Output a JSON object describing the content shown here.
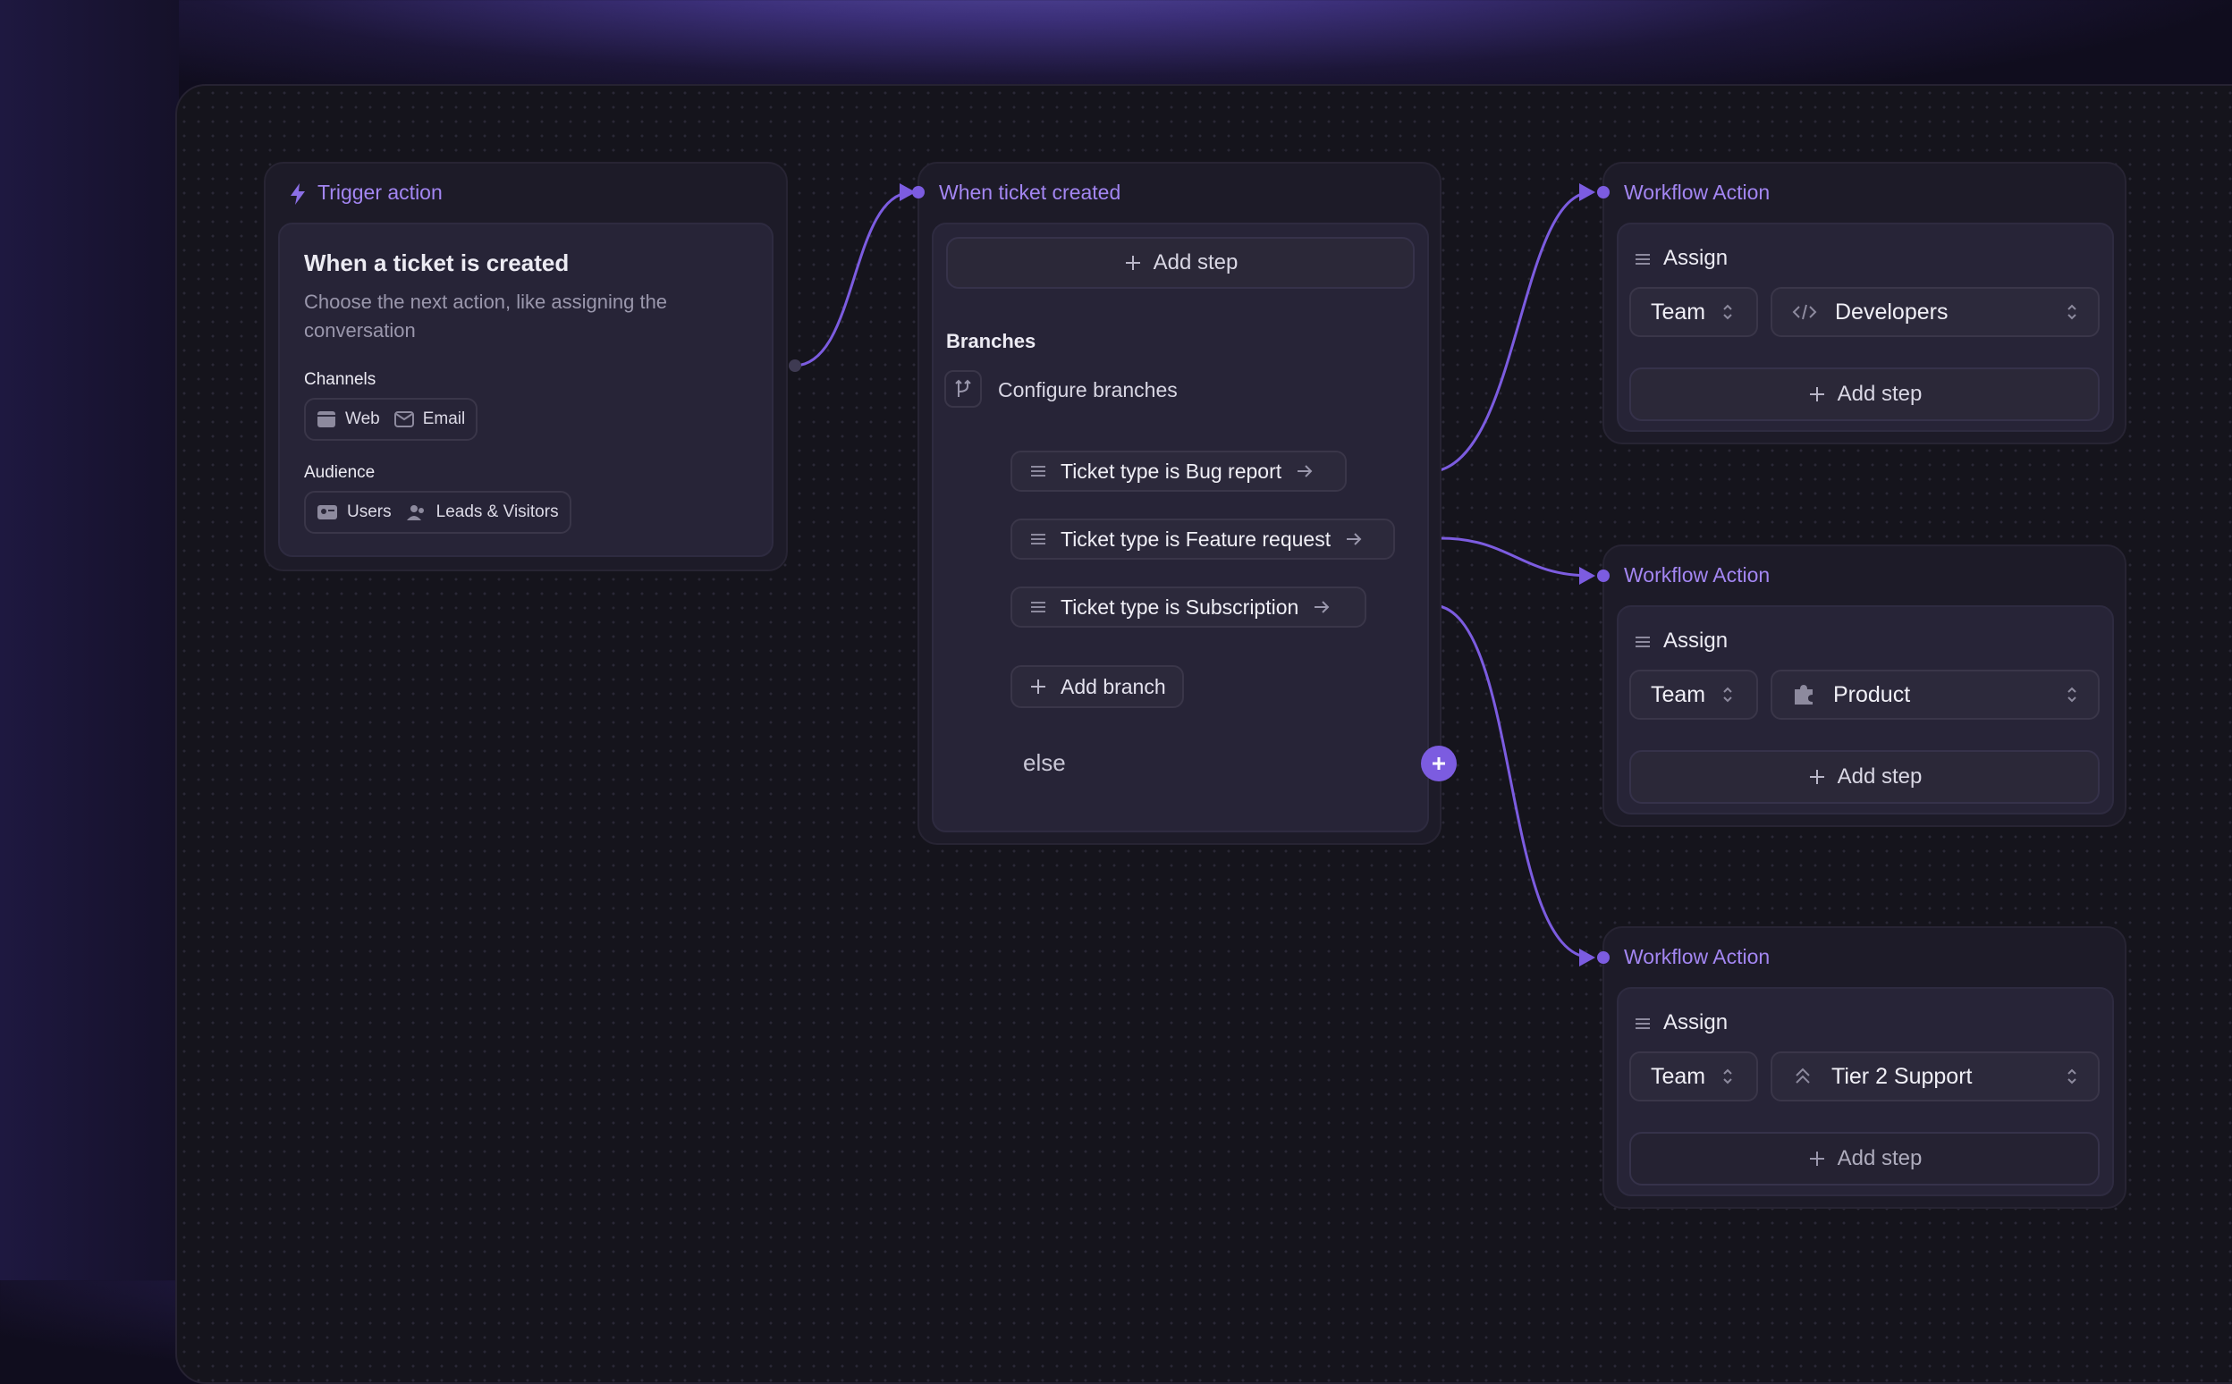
{
  "trigger": {
    "title": "Trigger action",
    "heading": "When a ticket is created",
    "description_line1": "Choose the next action, like assigning the",
    "description_line2": "conversation",
    "channels_label": "Channels",
    "channels": [
      "Web",
      "Email"
    ],
    "audience_label": "Audience",
    "audience": [
      "Users",
      "Leads & Visitors"
    ]
  },
  "branching": {
    "title": "When ticket created",
    "add_step": "Add step",
    "branches_label": "Branches",
    "configure_label": "Configure branches",
    "branches": [
      "Ticket type is Bug report",
      "Ticket type is Feature request",
      "Ticket type is Subscription"
    ],
    "add_branch": "Add branch",
    "else_label": "else"
  },
  "actions": [
    {
      "title": "Workflow Action",
      "action": "Assign",
      "field": "Team",
      "value": "Developers",
      "value_icon": "code-icon",
      "add_step": "Add step"
    },
    {
      "title": "Workflow Action",
      "action": "Assign",
      "field": "Team",
      "value": "Product",
      "value_icon": "puzzle-icon",
      "add_step": "Add step"
    },
    {
      "title": "Workflow Action",
      "action": "Assign",
      "field": "Team",
      "value": "Tier 2 Support",
      "value_icon": "chevrons-up-icon",
      "add_step": "Add step"
    }
  ],
  "colors": {
    "accent": "#7c5ce0",
    "title_purple": "#a386f2",
    "background": "#15141c"
  }
}
